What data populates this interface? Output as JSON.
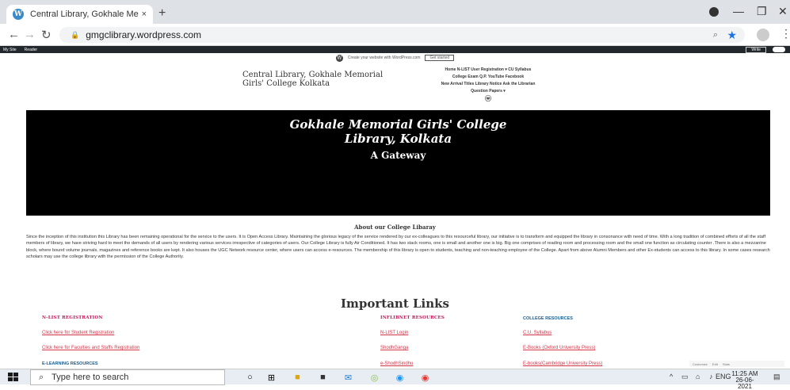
{
  "browser": {
    "tab_title": "Central Library, Gokhale Memori",
    "tab_close": "×",
    "new_tab": "+",
    "url": "gmgclibrary.wordpress.com",
    "favicon_letter": "W"
  },
  "wp_admin_bar": {
    "items": [
      "My Site",
      "Reader"
    ],
    "write_label": "Write"
  },
  "promo": {
    "text": "Create your website with WordPress.com",
    "button": "Get started"
  },
  "site": {
    "title_line1": "Central Library, Gokhale Memorial",
    "title_line2": "Girls' College Kolkata"
  },
  "nav": {
    "row1": "Home   N-LIST User Registration ▾   CU Syllabus",
    "row2": "College Exam Q.P.   YouTube   Facebook",
    "row3": "New Arrival Titles   Library Notice   Ask the Librarian",
    "row4": "Question Papers ▾"
  },
  "hero": {
    "title_line1": "Gokhale Memorial Girls' College",
    "title_line2": "Library, Kolkata",
    "subtitle": "A Gateway"
  },
  "about": {
    "heading": "About our College Libaray",
    "body": "Since the inception of this institution this Library has been remaining operational for the service to the users. It is Open Access Library. Maintaining the glorious legacy of the service rendered by our ex-colleagues to this resourceful library, our initiative is to transform and equipped the library in consonance with need of time. With a long tradition of combined efforts of all the staff members of library, we have striving hard to meet the demands of all users by rendering various services irrespective of categories of users. Our College Library is fully Air Conditioned. It has two stack rooms, one is small and another one is big. Big one comprises of reading room and processing room and the small one function as circulating counter .There is also a mezzanine block, where bound volume journals, magazines and reference books are kept. It also houses the UGC Network resource center, where users can access e-resources. The membership of this library is open to students, teaching and non-teaching employee of the College. Apart from above Alumni Members and other Ex-students can access to this library. In some cases research scholars may use the college library with the permission of the College Authority."
  },
  "links": {
    "heading": "Important Links",
    "col1": {
      "heading": "N-LIST REGISTRATION",
      "link1": "Click here for Student Registration",
      "link2": "Click here for Faculties and Staffs Registration",
      "sub": "E-LEARNING RESOURCES"
    },
    "col2": {
      "heading": "INFLIBNET RESOURCES",
      "link1": "N-LIST Login",
      "link2": "ShodhGanga",
      "link3": "e-ShodhSindhu"
    },
    "col3": {
      "heading": "COLLEGE RESOURCES",
      "link1": "C.U. Syllabus",
      "link2": "E-Books (Oxford University Press)",
      "link3": "E-books(Cambridge University Press)"
    }
  },
  "widget_footer": [
    "Customize",
    "Edit",
    "Stats"
  ],
  "taskbar": {
    "search_placeholder": "Type here to search",
    "lang": "ENG",
    "time": "11:25 AM",
    "date": "26-06-2021"
  },
  "colors": {
    "hero_bg": "#000000",
    "link_red": "#d3374a",
    "wp_bar": "#23282d"
  }
}
